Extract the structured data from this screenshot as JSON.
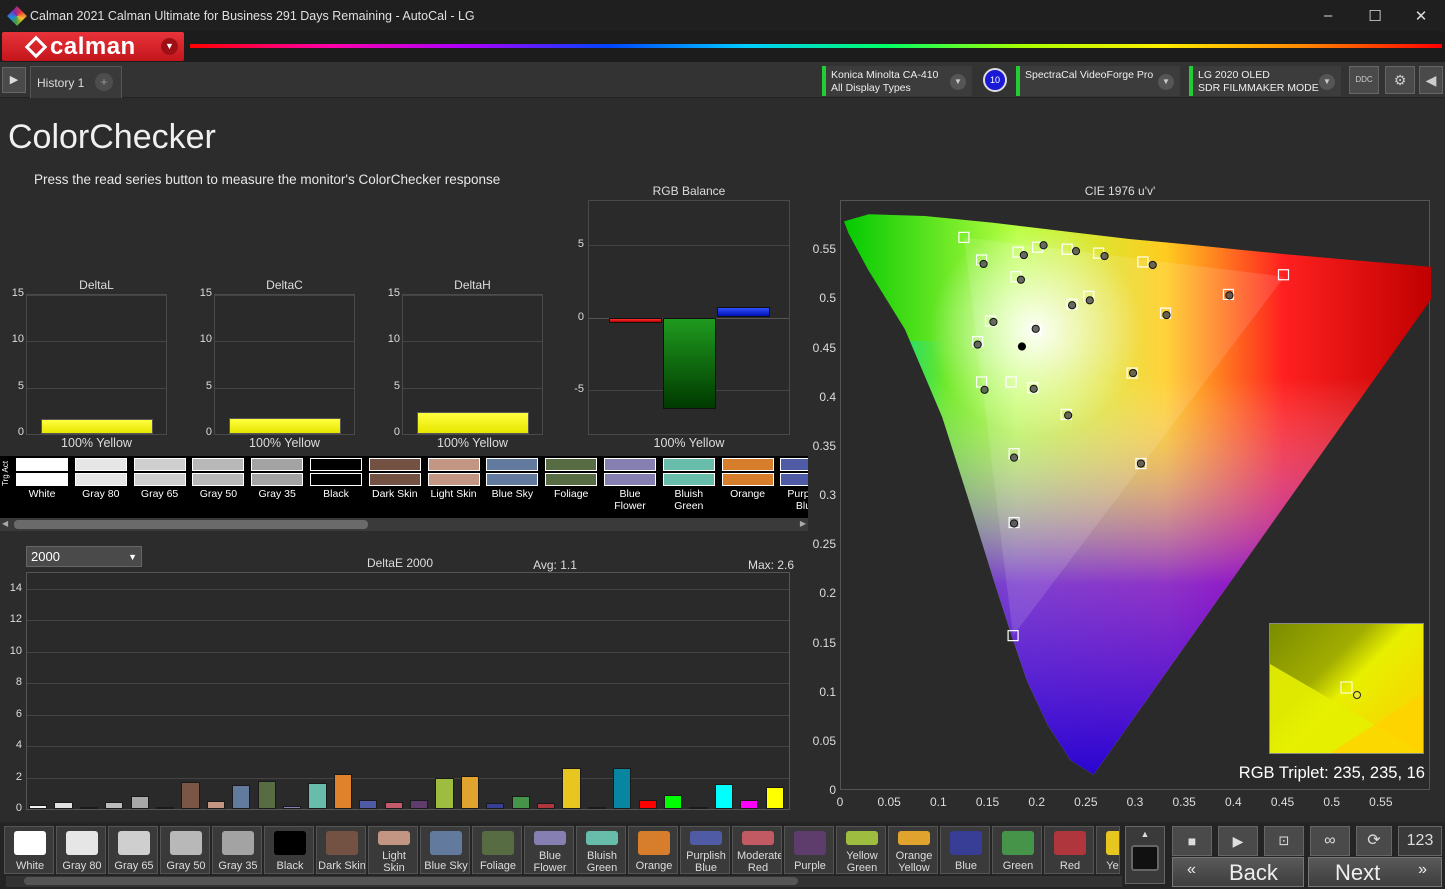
{
  "window": {
    "title": "Calman 2021 Calman Ultimate for Business 291 Days Remaining   -  AutoCal - LG",
    "minimize": "–",
    "maximize": "☐",
    "close": "✕"
  },
  "logo": {
    "text": "calman"
  },
  "tabs": {
    "history": "History 1",
    "add": "+"
  },
  "devices": {
    "meter_line1": "Konica Minolta CA-410",
    "meter_line2": "All Display Types",
    "meter_badge": "10",
    "generator": "SpectraCal VideoForge Pro",
    "display_line1": "LG 2020 OLED",
    "display_line2": "SDR FILMMAKER MODE",
    "ddc_icon": "DDC"
  },
  "page": {
    "title": "ColorChecker",
    "instruction": "Press the read series button to measure the monitor's ColorChecker response"
  },
  "delta_charts": [
    {
      "title": "DeltaL",
      "footer": "100% Yellow",
      "value": 1.6
    },
    {
      "title": "DeltaC",
      "footer": "100% Yellow",
      "value": 1.7
    },
    {
      "title": "DeltaH",
      "footer": "100% Yellow",
      "value": 2.4
    }
  ],
  "delta_ticks": [
    "15",
    "10",
    "5",
    "0"
  ],
  "rgb_balance": {
    "title": "RGB Balance",
    "footer": "100% Yellow",
    "ticks": [
      "5",
      "0",
      "-5"
    ],
    "red": -0.4,
    "green": -6.3,
    "blue": 0.7
  },
  "swatch_strip": {
    "side_label": "Trg Act",
    "items": [
      {
        "name": "White",
        "color": "#ffffff"
      },
      {
        "name": "Gray 80",
        "color": "#e6e6e6"
      },
      {
        "name": "Gray 65",
        "color": "#cfcfcf"
      },
      {
        "name": "Gray 50",
        "color": "#b8b8b8"
      },
      {
        "name": "Gray 35",
        "color": "#a3a3a3"
      },
      {
        "name": "Black",
        "color": "#000000"
      },
      {
        "name": "Dark Skin",
        "color": "#735244"
      },
      {
        "name": "Light Skin",
        "color": "#c29682"
      },
      {
        "name": "Blue Sky",
        "color": "#627a9d"
      },
      {
        "name": "Foliage",
        "color": "#576c43"
      },
      {
        "name": "Blue Flower",
        "color": "#8580b1"
      },
      {
        "name": "Bluish Green",
        "color": "#67bdaa"
      },
      {
        "name": "Orange",
        "color": "#d67e2c"
      },
      {
        "name": "Purplish Blue",
        "color": "#505ba6"
      }
    ]
  },
  "deltae": {
    "select_value": "2000",
    "title": "DeltaE 2000",
    "avg": "Avg: 1.1",
    "max": "Max: 2.6",
    "ticks": [
      "14",
      "12",
      "10",
      "8",
      "6",
      "4",
      "2",
      "0"
    ],
    "bars": [
      {
        "color": "#f2f2f2",
        "value": 0.25
      },
      {
        "color": "#e0e0e0",
        "value": 0.45
      },
      {
        "color": "#cccccc",
        "value": 0.15
      },
      {
        "color": "#bbbbbb",
        "value": 0.45
      },
      {
        "color": "#a8a8a8",
        "value": 0.8
      },
      {
        "color": "#222222",
        "value": 0.05
      },
      {
        "color": "#7a5646",
        "value": 1.7
      },
      {
        "color": "#c29682",
        "value": 0.5
      },
      {
        "color": "#627a9d",
        "value": 1.5
      },
      {
        "color": "#576c43",
        "value": 1.8
      },
      {
        "color": "#8580b1",
        "value": 0.2
      },
      {
        "color": "#67bdaa",
        "value": 1.65
      },
      {
        "color": "#e0822c",
        "value": 2.2
      },
      {
        "color": "#505ba6",
        "value": 0.55
      },
      {
        "color": "#c25a6a",
        "value": 0.45
      },
      {
        "color": "#5e3c6c",
        "value": 0.55
      },
      {
        "color": "#9dbc40",
        "value": 2.0
      },
      {
        "color": "#e0a32e",
        "value": 2.1
      },
      {
        "color": "#383d96",
        "value": 0.4
      },
      {
        "color": "#469449",
        "value": 0.8
      },
      {
        "color": "#af363c",
        "value": 0.4
      },
      {
        "color": "#e7c71f",
        "value": 2.6
      },
      {
        "color": "#bb5695",
        "value": 0.1
      },
      {
        "color": "#0885a1",
        "value": 2.6
      },
      {
        "color": "#ff0000",
        "value": 0.6
      },
      {
        "color": "#00ff00",
        "value": 0.9
      },
      {
        "color": "#0000ff",
        "value": 0.15
      },
      {
        "color": "#00ffff",
        "value": 1.6
      },
      {
        "color": "#ff00ff",
        "value": 0.6
      },
      {
        "color": "#ffff00",
        "value": 1.4
      }
    ]
  },
  "cie": {
    "title": "CIE 1976 u'v'",
    "x_ticks": [
      "0",
      "0.05",
      "0.1",
      "0.15",
      "0.2",
      "0.25",
      "0.3",
      "0.35",
      "0.4",
      "0.45",
      "0.5",
      "0.55"
    ],
    "y_ticks": [
      "0.55",
      "0.5",
      "0.45",
      "0.4",
      "0.35",
      "0.3",
      "0.25",
      "0.2",
      "0.15",
      "0.1",
      "0.05",
      "0"
    ],
    "triplet": "RGB Triplet: 235, 235, 16",
    "targets": [
      [
        0.125,
        0.563
      ],
      [
        0.143,
        0.54
      ],
      [
        0.18,
        0.548
      ],
      [
        0.2,
        0.553
      ],
      [
        0.23,
        0.551
      ],
      [
        0.262,
        0.547
      ],
      [
        0.307,
        0.538
      ],
      [
        0.45,
        0.525
      ],
      [
        0.178,
        0.523
      ],
      [
        0.394,
        0.505
      ],
      [
        0.252,
        0.503
      ],
      [
        0.235,
        0.495
      ],
      [
        0.33,
        0.486
      ],
      [
        0.152,
        0.478
      ],
      [
        0.198,
        0.47
      ],
      [
        0.139,
        0.457
      ],
      [
        0.143,
        0.416
      ],
      [
        0.173,
        0.416
      ],
      [
        0.195,
        0.41
      ],
      [
        0.296,
        0.425
      ],
      [
        0.229,
        0.383
      ],
      [
        0.176,
        0.343
      ],
      [
        0.305,
        0.333
      ],
      [
        0.176,
        0.273
      ],
      [
        0.175,
        0.158
      ],
      [
        0.517,
        0.103
      ]
    ],
    "measured": [
      [
        0.145,
        0.536
      ],
      [
        0.186,
        0.545
      ],
      [
        0.206,
        0.555
      ],
      [
        0.239,
        0.549
      ],
      [
        0.268,
        0.544
      ],
      [
        0.317,
        0.535
      ],
      [
        0.183,
        0.52
      ],
      [
        0.395,
        0.504
      ],
      [
        0.253,
        0.499
      ],
      [
        0.235,
        0.494
      ],
      [
        0.331,
        0.484
      ],
      [
        0.155,
        0.477
      ],
      [
        0.198,
        0.47
      ],
      [
        0.184,
        0.452
      ],
      [
        0.139,
        0.454
      ],
      [
        0.146,
        0.408
      ],
      [
        0.196,
        0.409
      ],
      [
        0.297,
        0.425
      ],
      [
        0.231,
        0.382
      ],
      [
        0.176,
        0.339
      ],
      [
        0.305,
        0.333
      ],
      [
        0.176,
        0.272
      ],
      [
        0.528,
        0.096
      ]
    ]
  },
  "bottom_patches": [
    {
      "name": "White",
      "color": "#ffffff"
    },
    {
      "name": "Gray 80",
      "color": "#e6e6e6"
    },
    {
      "name": "Gray 65",
      "color": "#cfcfcf"
    },
    {
      "name": "Gray 50",
      "color": "#b8b8b8"
    },
    {
      "name": "Gray 35",
      "color": "#a3a3a3"
    },
    {
      "name": "Black",
      "color": "#000000"
    },
    {
      "name": "Dark Skin",
      "color": "#735244"
    },
    {
      "name": "Light Skin",
      "color": "#c29682"
    },
    {
      "name": "Blue Sky",
      "color": "#627a9d"
    },
    {
      "name": "Foliage",
      "color": "#576c43"
    },
    {
      "name": "Blue Flower",
      "color": "#8580b1"
    },
    {
      "name": "Bluish Green",
      "color": "#67bdaa"
    },
    {
      "name": "Orange",
      "color": "#d67e2c"
    },
    {
      "name": "Purplish Blue",
      "color": "#505ba6"
    },
    {
      "name": "Moderate Red",
      "color": "#c15a63"
    },
    {
      "name": "Purple",
      "color": "#5e3c6c"
    },
    {
      "name": "Yellow Green",
      "color": "#9dbc40"
    },
    {
      "name": "Orange Yellow",
      "color": "#e0a32e"
    },
    {
      "name": "Blue",
      "color": "#383d96"
    },
    {
      "name": "Green",
      "color": "#469449"
    },
    {
      "name": "Red",
      "color": "#af363c"
    },
    {
      "name": "Yellow",
      "color": "#e7c71f"
    }
  ],
  "controls": {
    "back": "Back",
    "next": "Next",
    "counter": "123"
  }
}
